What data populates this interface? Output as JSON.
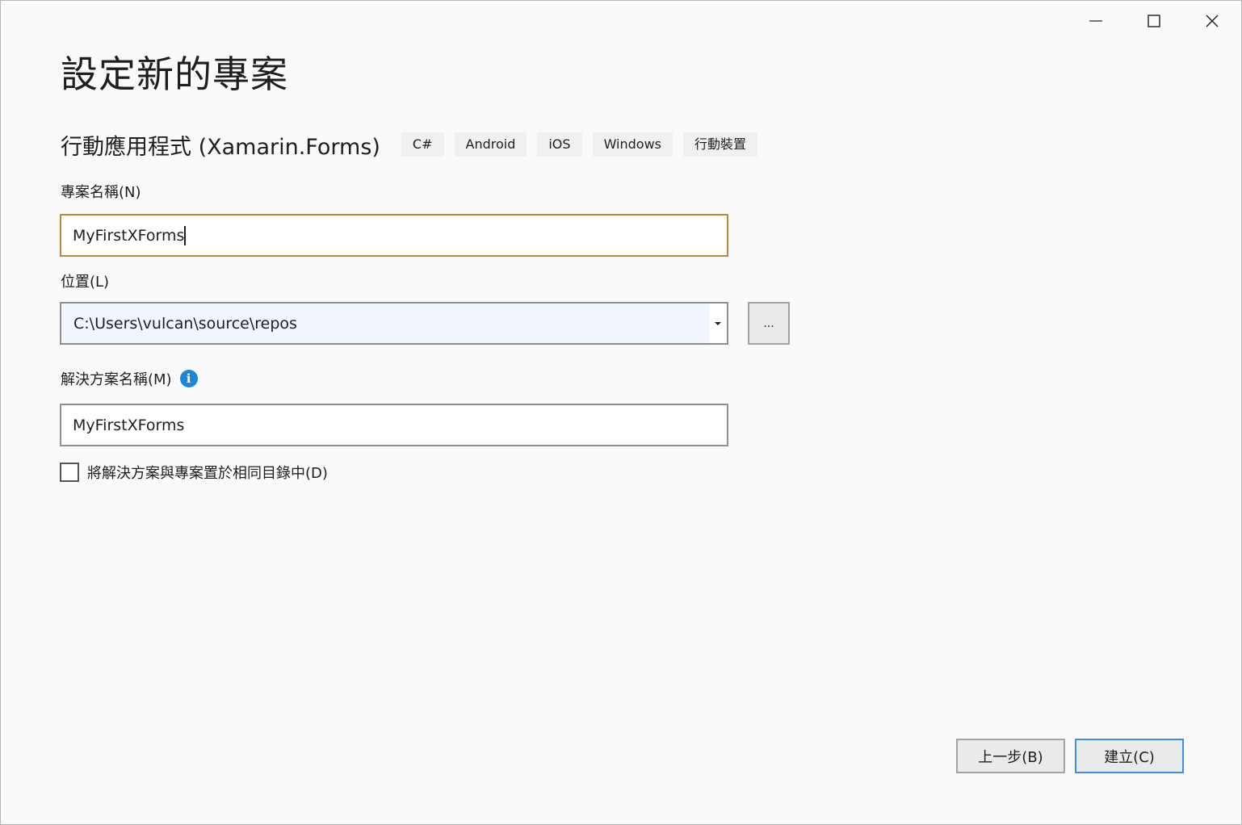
{
  "window": {
    "minimize_label": "Minimize",
    "maximize_label": "Maximize",
    "close_label": "Close"
  },
  "page": {
    "title": "設定新的專案"
  },
  "template": {
    "name": "行動應用程式 (Xamarin.Forms)",
    "tags": [
      "C#",
      "Android",
      "iOS",
      "Windows",
      "行動裝置"
    ]
  },
  "project_name": {
    "label": "專案名稱(N)",
    "value": "MyFirstXForms"
  },
  "location": {
    "label": "位置(L)",
    "value": "C:\\Users\\vulcan\\source\\repos",
    "browse_label": "..."
  },
  "solution_name": {
    "label": "解決方案名稱(M)",
    "info_icon": "i",
    "value": "MyFirstXForms"
  },
  "same_directory": {
    "label": "將解決方案與專案置於相同目錄中(D)",
    "checked": false
  },
  "footer": {
    "back_label": "上一步(B)",
    "create_label": "建立(C)"
  },
  "colors": {
    "focus_border": "#b5883a",
    "primary_border": "#3d8ee6",
    "info_blue": "#1c86d8"
  }
}
